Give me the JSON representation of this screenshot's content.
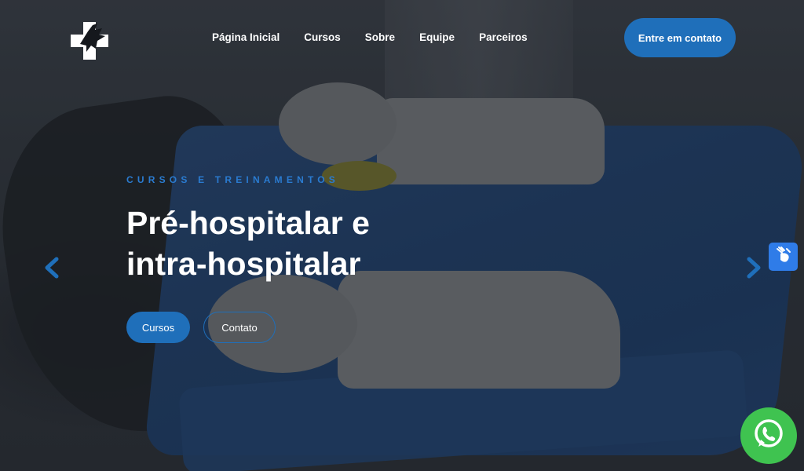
{
  "header": {
    "logo_icon": "eagle-cross-logo",
    "nav": [
      {
        "label": "Página Inicial"
      },
      {
        "label": "Cursos"
      },
      {
        "label": "Sobre"
      },
      {
        "label": "Equipe"
      },
      {
        "label": "Parceiros"
      }
    ],
    "cta_label": "Entre em contato"
  },
  "hero": {
    "eyebrow": "CURSOS E TREINAMENTOS",
    "headline_line1": "Pré-hospitalar e",
    "headline_line2": "intra-hospitalar",
    "primary_button": "Cursos",
    "secondary_button": "Contato",
    "prev_icon": "chevron-left-icon",
    "next_icon": "chevron-right-icon"
  },
  "widgets": {
    "accessibility_icon": "sign-language-icon",
    "whatsapp_icon": "whatsapp-icon"
  },
  "colors": {
    "accent": "#1f6fba",
    "eyebrow": "#2a7bd0",
    "whatsapp": "#3fc350",
    "accessibility": "#2f7ce8"
  }
}
